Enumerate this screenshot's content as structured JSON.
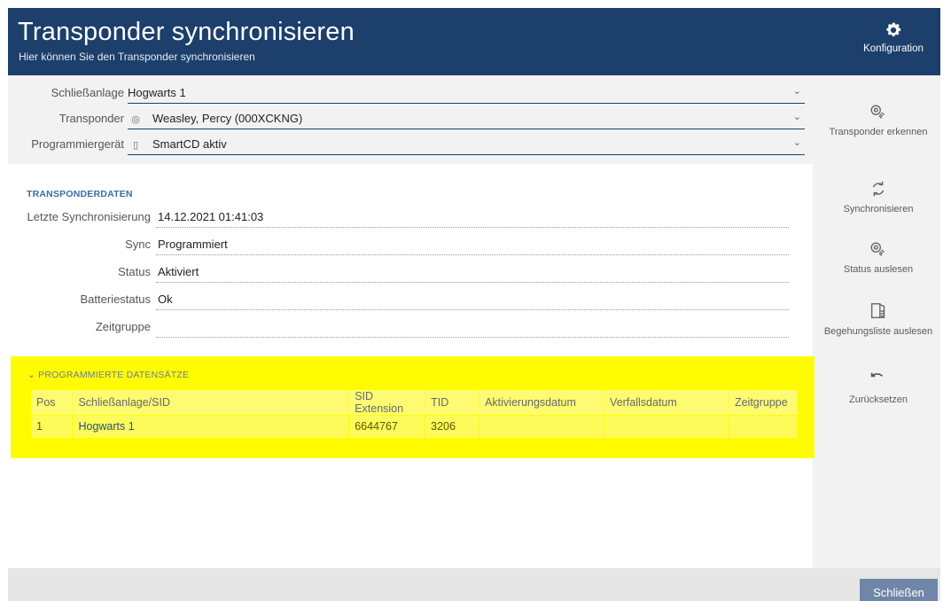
{
  "header": {
    "title": "Transponder synchronisieren",
    "subtitle": "Hier können Sie den Transponder synchronisieren",
    "config_label": "Konfiguration"
  },
  "form": {
    "schliessanlage_label": "Schließanlage",
    "schliessanlage_value": "Hogwarts 1",
    "transponder_label": "Transponder",
    "transponder_value": "Weasley, Percy (000XCKNG)",
    "programmiergeraet_label": "Programmiergerät",
    "programmiergeraet_value": "SmartCD aktiv"
  },
  "transponderdaten": {
    "section_title": "TRANSPONDERDATEN",
    "rows": [
      {
        "label": "Letzte Synchronisierung",
        "value": "14.12.2021 01:41:03"
      },
      {
        "label": "Sync",
        "value": "Programmiert"
      },
      {
        "label": "Status",
        "value": "Aktiviert"
      },
      {
        "label": "Batteriestatus",
        "value": "Ok"
      },
      {
        "label": "Zeitgruppe",
        "value": ""
      }
    ]
  },
  "datensaetze": {
    "section_title": "PROGRAMMIERTE DATENSÄTZE",
    "columns": [
      "Pos",
      "Schließanlage/SID",
      "SID Extension",
      "TID",
      "Aktivierungsdatum",
      "Verfallsdatum",
      "Zeitgruppe"
    ],
    "rows": [
      [
        "1",
        "Hogwarts 1",
        "6644767",
        "3206",
        "",
        "",
        ""
      ]
    ]
  },
  "side": {
    "transponder_erkennen": "Transponder erkennen",
    "synchronisieren": "Synchronisieren",
    "status_auslesen": "Status auslesen",
    "begehungsliste_auslesen": "Begehungsliste auslesen",
    "zuruecksetzen": "Zurücksetzen"
  },
  "footer": {
    "close_label": "Schließen"
  },
  "colors": {
    "header_bg": "#1c3f6b",
    "highlight": "#fffb00",
    "accent": "#3a6ea5",
    "close_button": "#6f86a8"
  }
}
